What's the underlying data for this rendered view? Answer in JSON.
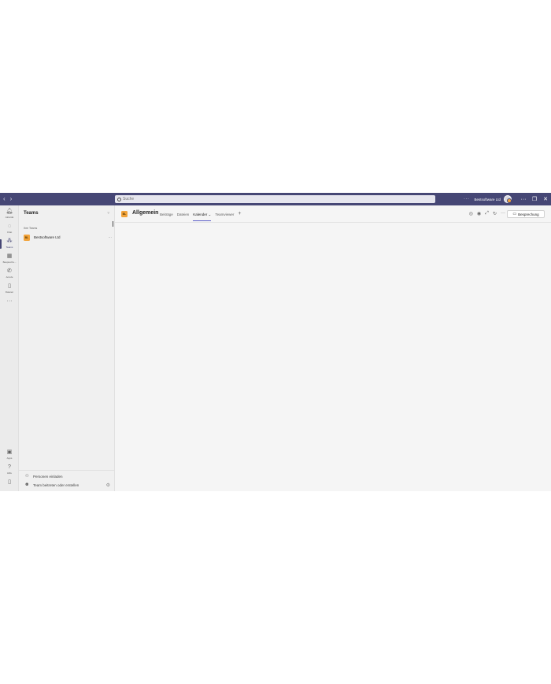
{
  "titlebar": {
    "back": "‹",
    "forward": "›",
    "search_placeholder": "Suche",
    "more": "···",
    "org_name": "Bestsoftware Ltd",
    "window_more": "···",
    "restore": "❐",
    "close": "✕"
  },
  "rail": {
    "items": [
      {
        "label": "Aktivität",
        "icon": "bell-icon"
      },
      {
        "label": "Chat",
        "icon": "chat-icon"
      },
      {
        "label": "Teams",
        "icon": "teams-icon"
      },
      {
        "label": "Besprechu...",
        "icon": "calendar-icon"
      },
      {
        "label": "Anrufe",
        "icon": "phone-icon"
      },
      {
        "label": "Dateien",
        "icon": "file-icon"
      }
    ],
    "more": "···",
    "apps_label": "Apps",
    "help_label": "Hilfe"
  },
  "teams_pane": {
    "title": "Teams",
    "section_label": "Ihre Teams",
    "teams": [
      {
        "initials": "BL",
        "name": "Bestsoftware Ltd",
        "more": "···"
      }
    ],
    "invite_label": "Personen einladen",
    "join_label": "Team beitreten oder erstellen"
  },
  "channel": {
    "badge": "BL",
    "title": "Allgemein",
    "tabs": [
      {
        "label": "Beiträge",
        "active": false
      },
      {
        "label": "Dateien",
        "active": false
      },
      {
        "label": "Kalender ⌄",
        "active": true
      },
      {
        "label": "Teamviewer",
        "active": false
      }
    ],
    "add_tab": "+",
    "more": "···",
    "meeting_label": "Besprechung"
  },
  "colors": {
    "titlebar": "#464775",
    "accent": "#5b5fc7",
    "team_badge": "#f2a33a"
  }
}
